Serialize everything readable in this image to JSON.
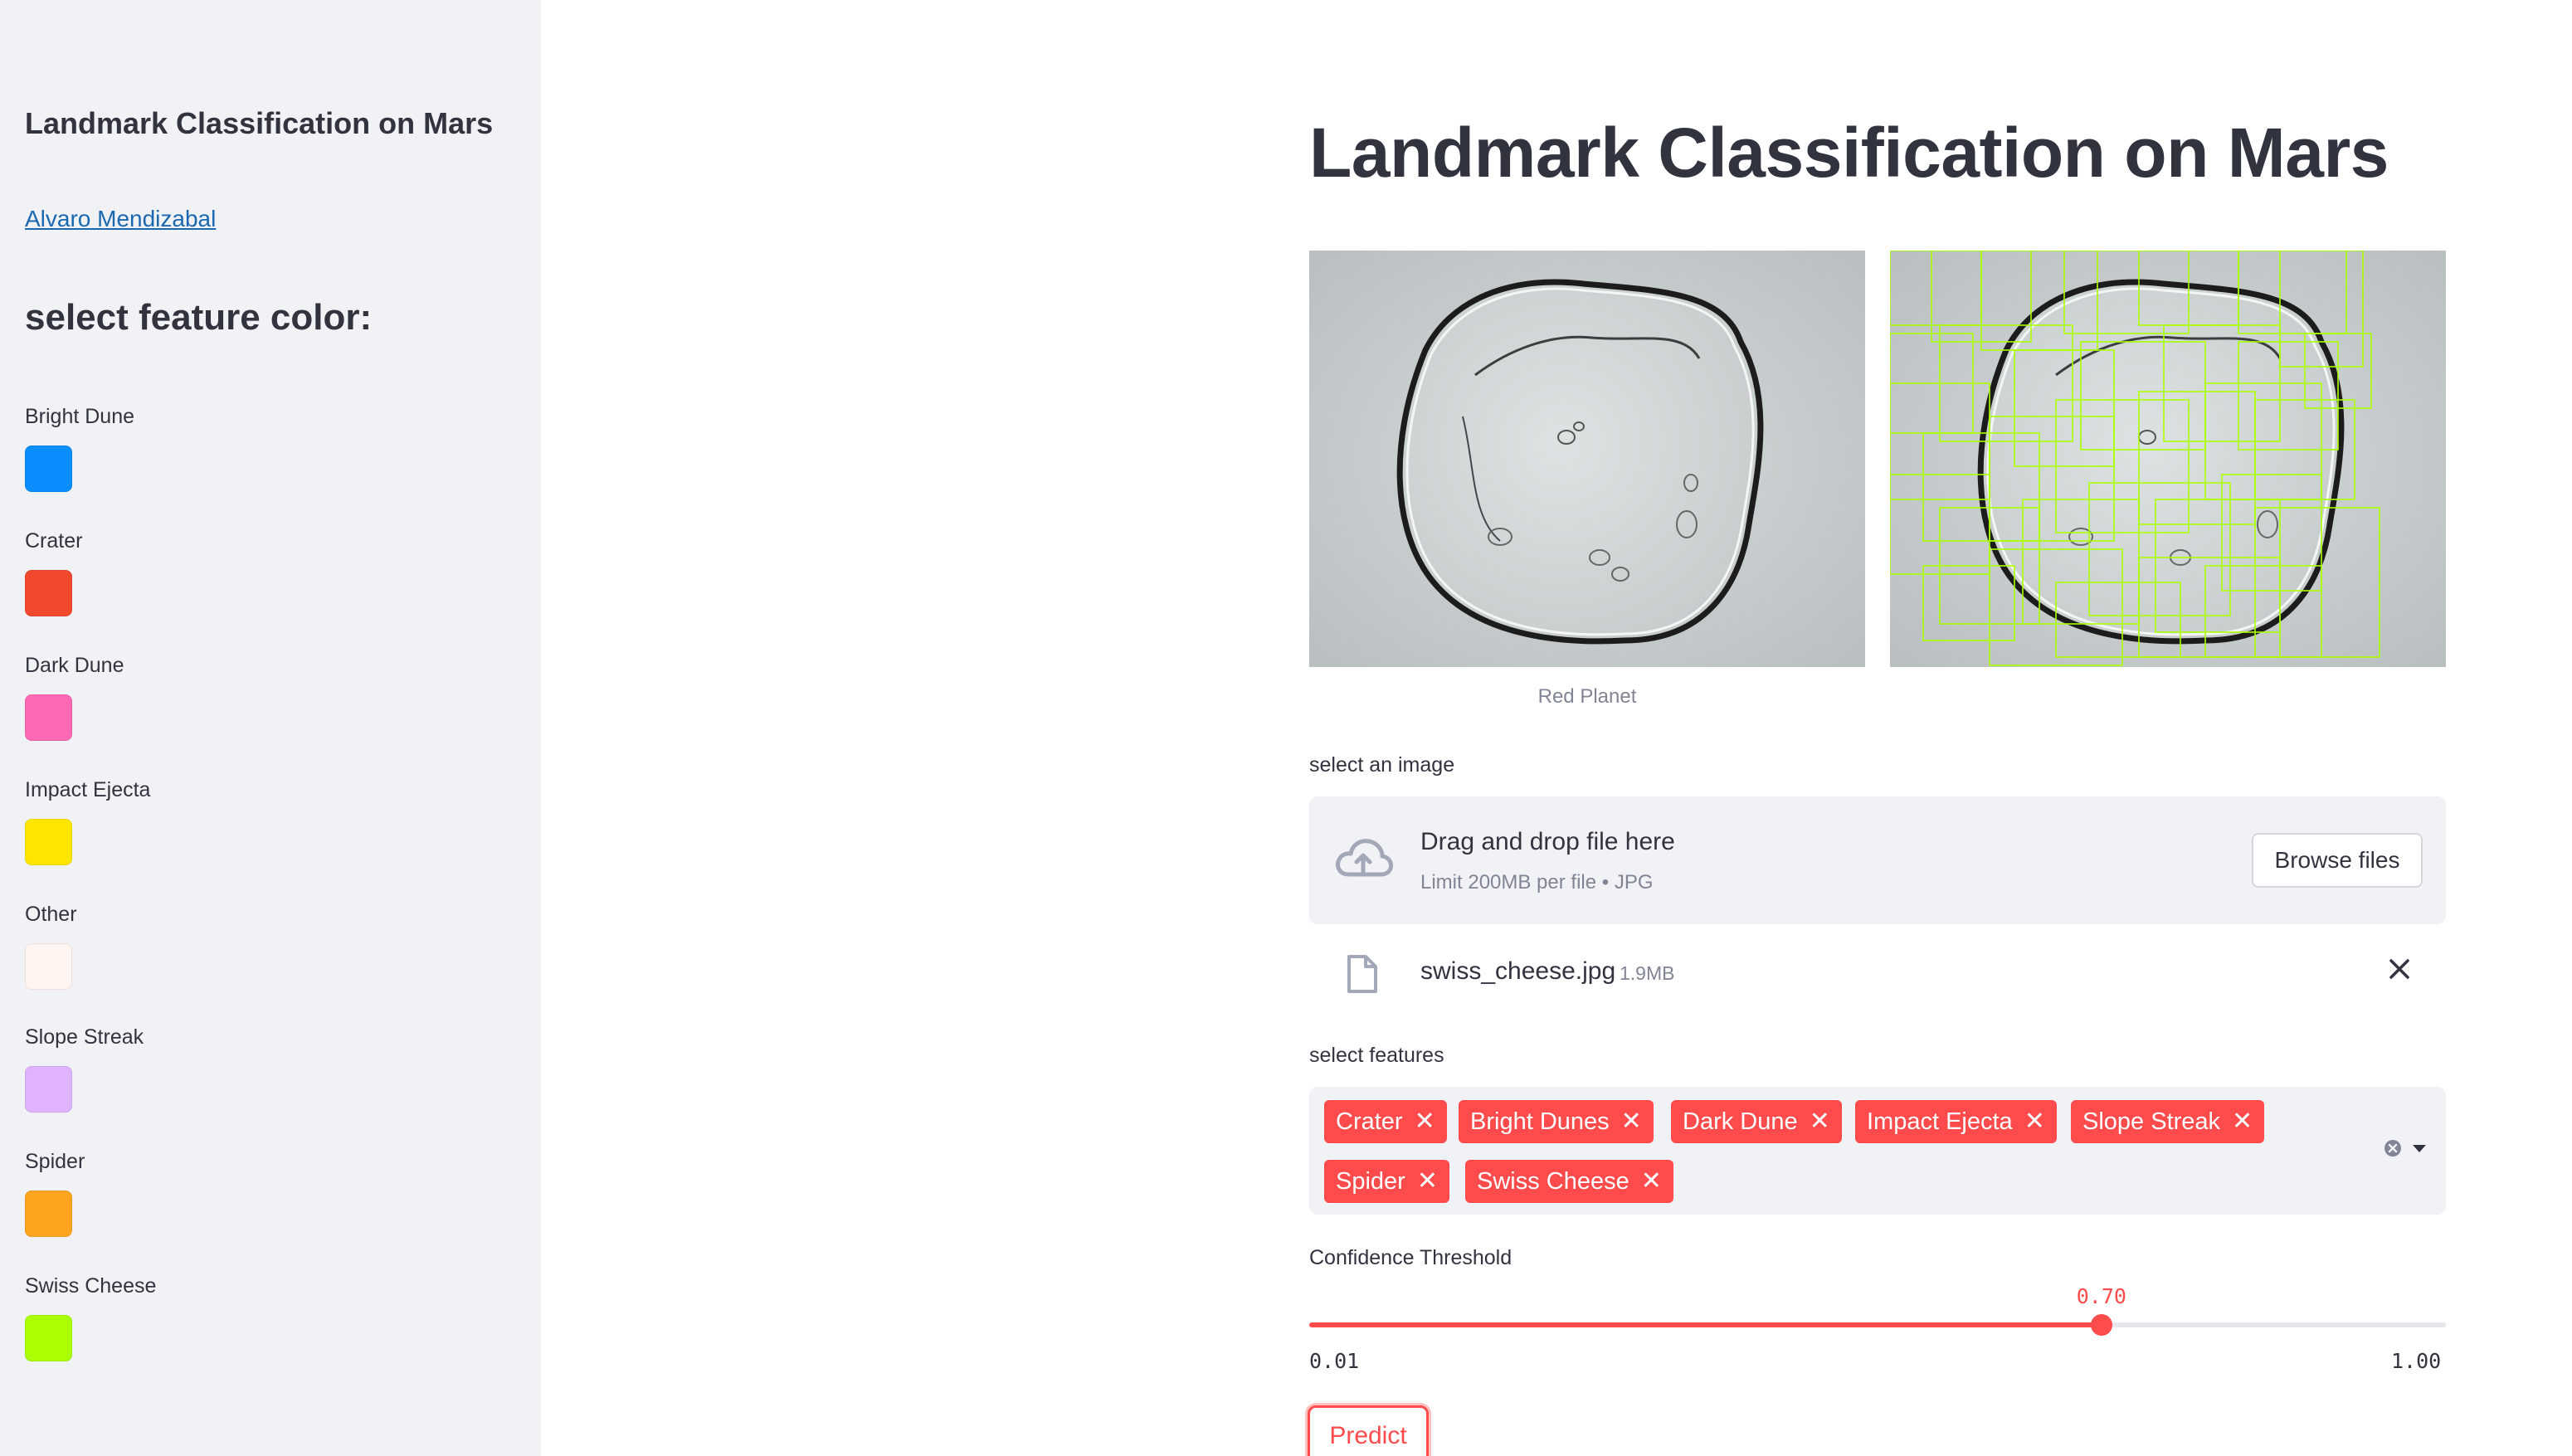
{
  "sidebar": {
    "title": "Landmark Classification on Mars",
    "author": "Alvaro Mendizabal",
    "heading": "select feature color:",
    "colors": [
      {
        "label": "Bright Dune",
        "color": "#0a8eff"
      },
      {
        "label": "Crater",
        "color": "#f2492c"
      },
      {
        "label": "Dark Dune",
        "color": "#ff69b4"
      },
      {
        "label": "Impact Ejecta",
        "color": "#ffe600"
      },
      {
        "label": "Other",
        "color": "#fff4ef"
      },
      {
        "label": "Slope Streak",
        "color": "#dfb3ff"
      },
      {
        "label": "Spider",
        "color": "#ffa41f"
      },
      {
        "label": "Swiss Cheese",
        "color": "#aaff00"
      }
    ]
  },
  "main": {
    "title": "Landmark Classification on Mars",
    "image_caption": "Red Planet",
    "detection_box_color": "#aaff00"
  },
  "uploader": {
    "label": "select an image",
    "drop_text": "Drag and drop file here",
    "limit_text": "Limit 200MB per file • JPG",
    "browse_label": "Browse files",
    "file_name": "swiss_cheese.jpg",
    "file_size": "1.9MB"
  },
  "features": {
    "label": "select features",
    "selected": [
      "Crater",
      "Bright Dunes",
      "Dark Dune",
      "Impact Ejecta",
      "Slope Streak",
      "Spider",
      "Swiss Cheese"
    ],
    "tag_color": "#ff4b4b"
  },
  "threshold": {
    "label": "Confidence Threshold",
    "value": "0.70",
    "min": "0.01",
    "max": "1.00"
  },
  "predict_label": "Predict"
}
